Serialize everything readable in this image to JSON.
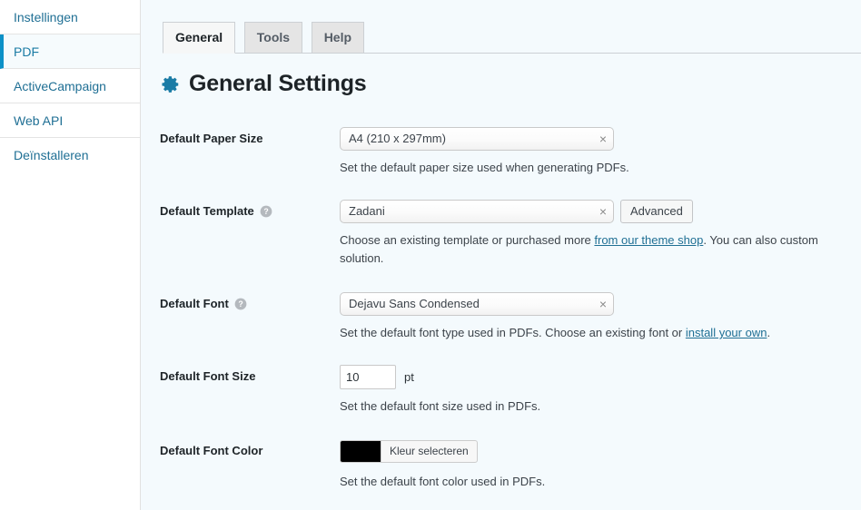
{
  "sidebar": {
    "items": [
      {
        "label": "Instellingen",
        "current": false
      },
      {
        "label": "PDF",
        "current": true
      },
      {
        "label": "ActiveCampaign",
        "current": false
      },
      {
        "label": "Web API",
        "current": false
      },
      {
        "label": "Deïnstalleren",
        "current": false
      }
    ]
  },
  "tabs": [
    {
      "label": "General",
      "active": true
    },
    {
      "label": "Tools",
      "active": false
    },
    {
      "label": "Help",
      "active": false
    }
  ],
  "header": {
    "title": "General Settings",
    "icon": "gear-icon",
    "icon_color": "#1b7ca6"
  },
  "fields": {
    "paper_size": {
      "label": "Default Paper Size",
      "value": "A4 (210 x 297mm)",
      "clear": "×",
      "description": "Set the default paper size used when generating PDFs."
    },
    "template": {
      "label": "Default Template",
      "help": "?",
      "value": "Zadani",
      "clear": "×",
      "advanced_button": "Advanced",
      "desc_part1": "Choose an existing template or purchased more ",
      "desc_link": "from our theme shop",
      "desc_part2": ". You can also ",
      "desc_part3": "custom solution."
    },
    "font": {
      "label": "Default Font",
      "help": "?",
      "value": "Dejavu Sans Condensed",
      "clear": "×",
      "desc_part1": "Set the default font type used in PDFs. Choose an existing font or ",
      "desc_link": "install your own",
      "desc_part2": "."
    },
    "font_size": {
      "label": "Default Font Size",
      "value": "10",
      "unit": "pt",
      "description": "Set the default font size used in PDFs."
    },
    "font_color": {
      "label": "Default Font Color",
      "swatch_color": "#000000",
      "button_label": "Kleur selecteren",
      "description": "Set the default font color used in PDFs."
    }
  }
}
